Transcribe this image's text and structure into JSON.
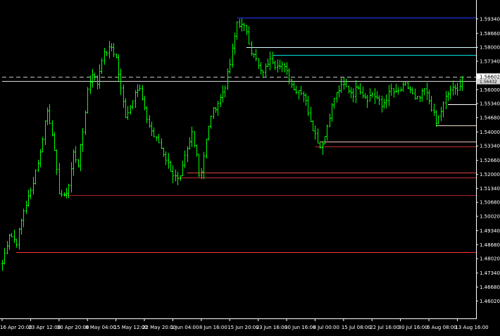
{
  "chart_data": {
    "type": "candlestick",
    "price_axis": {
      "ticks": [
        "1.59340",
        "1.58660",
        "1.58000",
        "1.57340",
        "1.56000",
        "1.55340",
        "1.54680",
        "1.54000",
        "1.53340",
        "1.52660",
        "1.52000",
        "1.51340",
        "1.50680",
        "1.50020",
        "1.49340",
        "1.48680",
        "1.48020",
        "1.47340",
        "1.46680",
        "1.46020"
      ],
      "tick_values": [
        1.5934,
        1.5866,
        1.58,
        1.5734,
        1.56,
        1.5534,
        1.5468,
        1.54,
        1.5334,
        1.5266,
        1.52,
        1.5134,
        1.5068,
        1.5002,
        1.4934,
        1.4868,
        1.4802,
        1.4734,
        1.4668,
        1.4602
      ],
      "range": [
        1.452,
        1.599
      ],
      "current_price_label": "1.56602",
      "secondary_label": "1.56432"
    },
    "time_axis": {
      "labels": [
        "16 Apr 20:00",
        "23 Apr 12:00",
        "30 Apr 20:00",
        "8 May 04:00",
        "15 May 12:00",
        "22 May 20:00",
        "1 Jun 04:00",
        "8 Jun 16:00",
        "15 Jun 20:00",
        "23 Jun 16:00",
        "30 Jun 16:00",
        "8 Jul 00:00",
        "15 Jul 08:00",
        "22 Jul 16:00",
        "30 Jul 16:00",
        "6 Aug 08:00",
        "13 Aug 16:00"
      ],
      "label_bar_index": [
        0,
        12,
        24,
        36,
        48,
        60,
        72,
        84,
        96,
        108,
        120,
        132,
        144,
        156,
        168,
        180,
        192
      ]
    },
    "price_path": [
      [
        0,
        1.478
      ],
      [
        3,
        1.492
      ],
      [
        6,
        1.488
      ],
      [
        9,
        1.503
      ],
      [
        12,
        1.512
      ],
      [
        14,
        1.522
      ],
      [
        16,
        1.53
      ],
      [
        18,
        1.545
      ],
      [
        19,
        1.55
      ],
      [
        21,
        1.54
      ],
      [
        22,
        1.53
      ],
      [
        24,
        1.512
      ],
      [
        26,
        1.509
      ],
      [
        28,
        1.515
      ],
      [
        30,
        1.53
      ],
      [
        32,
        1.525
      ],
      [
        34,
        1.54
      ],
      [
        36,
        1.56
      ],
      [
        38,
        1.568
      ],
      [
        40,
        1.563
      ],
      [
        42,
        1.575
      ],
      [
        44,
        1.578
      ],
      [
        46,
        1.58
      ],
      [
        48,
        1.575
      ],
      [
        50,
        1.56
      ],
      [
        52,
        1.548
      ],
      [
        54,
        1.552
      ],
      [
        56,
        1.56
      ],
      [
        58,
        1.56
      ],
      [
        60,
        1.55
      ],
      [
        62,
        1.543
      ],
      [
        64,
        1.538
      ],
      [
        66,
        1.535
      ],
      [
        68,
        1.53
      ],
      [
        70,
        1.525
      ],
      [
        72,
        1.52
      ],
      [
        74,
        1.517
      ],
      [
        75,
        1.518
      ],
      [
        77,
        1.528
      ],
      [
        79,
        1.535
      ],
      [
        80,
        1.54
      ],
      [
        82,
        1.53
      ],
      [
        83,
        1.52
      ],
      [
        84,
        1.522
      ],
      [
        86,
        1.536
      ],
      [
        88,
        1.548
      ],
      [
        90,
        1.552
      ],
      [
        92,
        1.556
      ],
      [
        94,
        1.562
      ],
      [
        96,
        1.572
      ],
      [
        98,
        1.585
      ],
      [
        99,
        1.592
      ],
      [
        101,
        1.59
      ],
      [
        103,
        1.588
      ],
      [
        105,
        1.578
      ],
      [
        107,
        1.574
      ],
      [
        109,
        1.568
      ],
      [
        111,
        1.57
      ],
      [
        113,
        1.576
      ],
      [
        115,
        1.572
      ],
      [
        117,
        1.57
      ],
      [
        119,
        1.572
      ],
      [
        121,
        1.566
      ],
      [
        123,
        1.56
      ],
      [
        125,
        1.56
      ],
      [
        127,
        1.558
      ],
      [
        129,
        1.55
      ],
      [
        131,
        1.542
      ],
      [
        133,
        1.536
      ],
      [
        134,
        1.533
      ],
      [
        136,
        1.538
      ],
      [
        138,
        1.548
      ],
      [
        140,
        1.556
      ],
      [
        142,
        1.56
      ],
      [
        144,
        1.562
      ],
      [
        146,
        1.56
      ],
      [
        148,
        1.558
      ],
      [
        150,
        1.562
      ],
      [
        152,
        1.558
      ],
      [
        154,
        1.556
      ],
      [
        156,
        1.558
      ],
      [
        158,
        1.556
      ],
      [
        160,
        1.552
      ],
      [
        162,
        1.556
      ],
      [
        164,
        1.56
      ],
      [
        166,
        1.558
      ],
      [
        168,
        1.56
      ],
      [
        170,
        1.562
      ],
      [
        172,
        1.56
      ],
      [
        174,
        1.555
      ],
      [
        176,
        1.556
      ],
      [
        178,
        1.56
      ],
      [
        180,
        1.555
      ],
      [
        182,
        1.548
      ],
      [
        183,
        1.544
      ],
      [
        185,
        1.55
      ],
      [
        187,
        1.556
      ],
      [
        189,
        1.56
      ],
      [
        191,
        1.56
      ],
      [
        193,
        1.562
      ],
      [
        194,
        1.566
      ]
    ],
    "horizontal_levels": [
      {
        "price": 1.5941,
        "color": "#1e3cff",
        "from_bar": 99
      },
      {
        "price": 1.5802,
        "color": "#d7ffff",
        "from_bar": 103
      },
      {
        "price": 1.5765,
        "color": "#00e0e0",
        "from_bar": 114
      },
      {
        "price": 1.566,
        "color": "#c0c0c0",
        "from_bar": 0,
        "dashed": true
      },
      {
        "price": 1.5642,
        "color": "#d8d8d8",
        "from_bar": 0
      },
      {
        "price": 1.553,
        "color": "#ffffff",
        "from_bar": 188
      },
      {
        "price": 1.543,
        "color": "#f2d9c6",
        "from_bar": 183
      },
      {
        "price": 1.5354,
        "color": "#e8c0b0",
        "from_bar": 134
      },
      {
        "price": 1.5333,
        "color": "#c03030",
        "from_bar": 132
      },
      {
        "price": 1.5208,
        "color": "#e04040",
        "from_bar": 78
      },
      {
        "price": 1.5184,
        "color": "#c03030",
        "from_bar": 74
      },
      {
        "price": 1.5102,
        "color": "#b02020",
        "from_bar": 26
      },
      {
        "price": 1.4834,
        "color": "#ff3030",
        "from_bar": 6
      }
    ],
    "colors": {
      "background": "#000000",
      "bars": "#00ff00",
      "axis": "#ffffff"
    }
  }
}
